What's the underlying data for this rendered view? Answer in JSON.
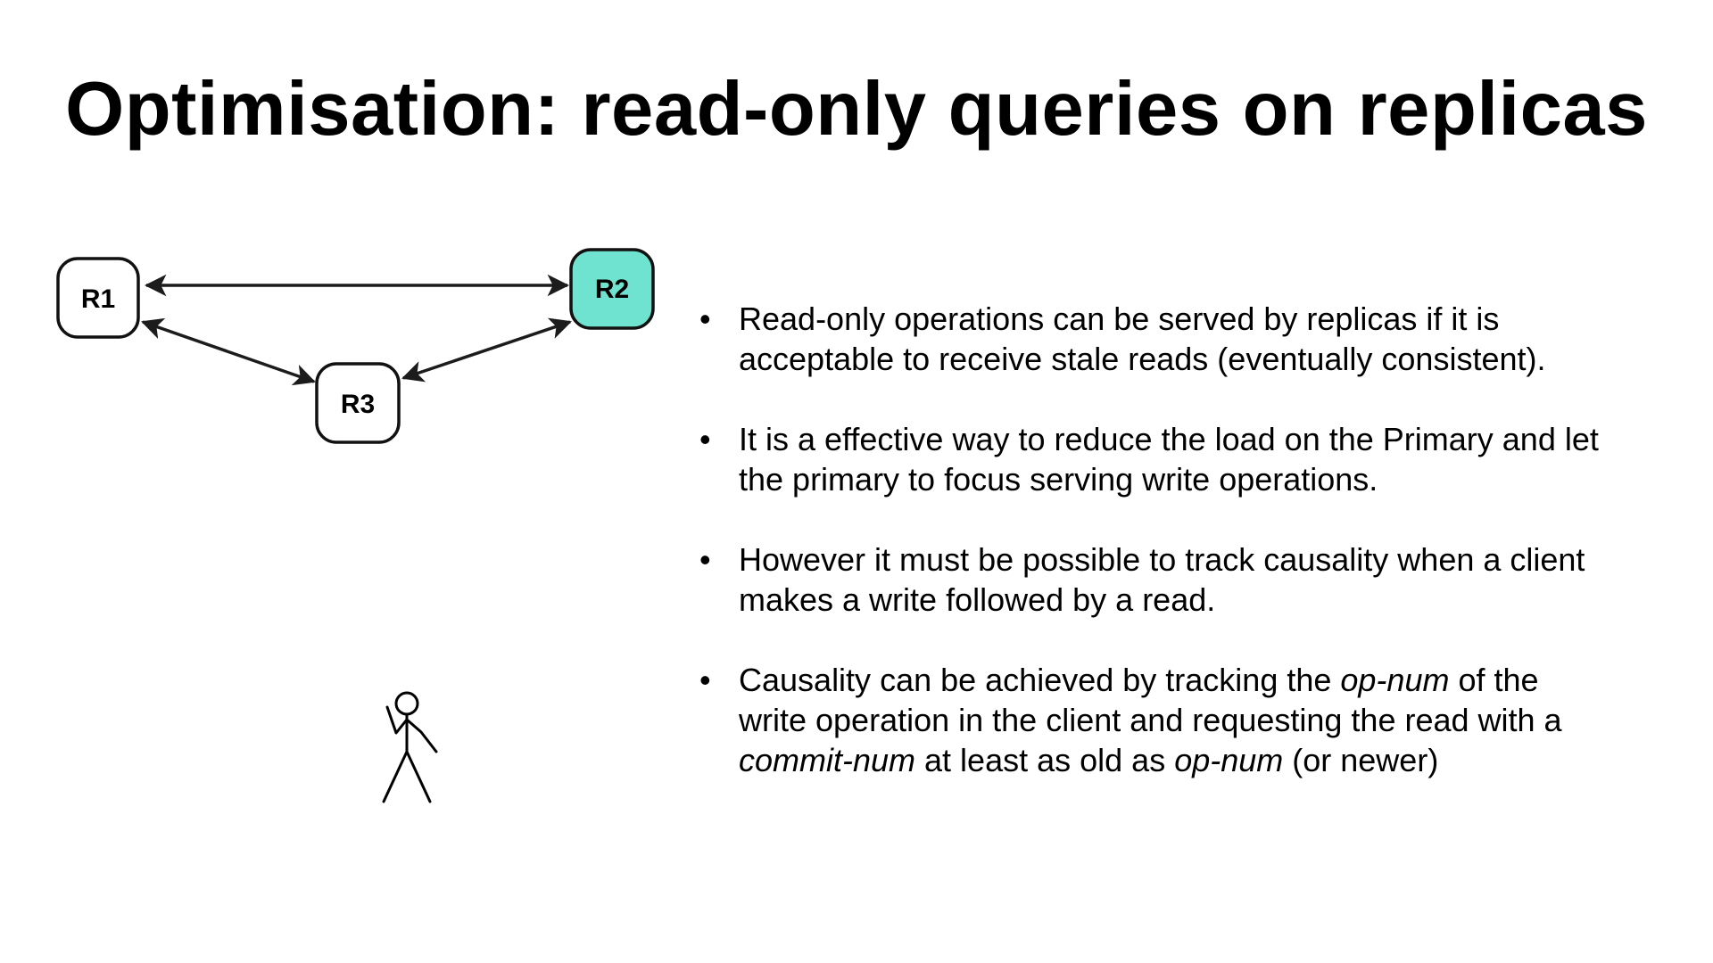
{
  "title": "Optimisation: read-only queries on replicas",
  "diagram": {
    "nodes": [
      {
        "id": "R1",
        "label": "R1",
        "highlighted": false
      },
      {
        "id": "R2",
        "label": "R2",
        "highlighted": true
      },
      {
        "id": "R3",
        "label": "R3",
        "highlighted": false
      }
    ],
    "edges": [
      {
        "from": "R1",
        "to": "R2",
        "direction": "bidirectional"
      },
      {
        "from": "R1",
        "to": "R3",
        "direction": "bidirectional"
      },
      {
        "from": "R3",
        "to": "R2",
        "direction": "bidirectional"
      }
    ],
    "colors": {
      "highlight_fill": "#6fe3cf",
      "node_fill": "#ffffff",
      "stroke": "#111111"
    },
    "client_icon": "stick-figure-icon"
  },
  "bullets": {
    "b1": {
      "line1": "Read-only operations can be served by replicas if it is",
      "line2": "acceptable to receive stale reads (eventually consistent)."
    },
    "b2": {
      "line1": "It is a effective way to reduce the load on the Primary and let",
      "line2": "the primary to focus serving write operations."
    },
    "b3": {
      "line1": "However it must be possible to track causality when a client",
      "line2": "makes a write followed by a read."
    },
    "b4": {
      "p1": "Causality can be achieved by tracking the ",
      "op_num": "op-num",
      "p2": " of the",
      "line2": "write operation in the client and requesting the read with a",
      "commit_num": "commit-num",
      "p3": " at least as old as ",
      "op_num_2": "op-num",
      "p4": " (or newer)"
    }
  }
}
